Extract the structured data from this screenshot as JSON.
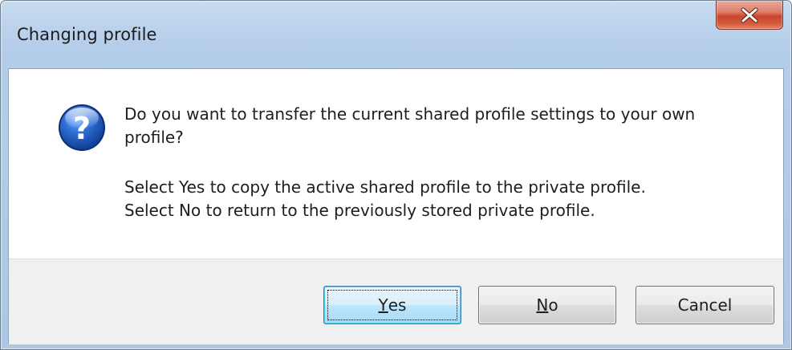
{
  "window": {
    "title": "Changing profile",
    "close_icon": "close-icon",
    "accent_color": "#c9462c"
  },
  "dialog": {
    "icon": "question-icon",
    "icon_color": "#2a5bb5",
    "question": "Do you want to transfer the current shared profile settings to your own profile?",
    "detail_line_1": "Select Yes to copy the active shared profile to the private profile.",
    "detail_line_2": "Select No to return to the previously stored private profile."
  },
  "buttons": {
    "yes": {
      "accel": "Y",
      "rest": "es",
      "focused": true
    },
    "no": {
      "accel": "N",
      "rest": "o"
    },
    "cancel": {
      "label": "Cancel"
    }
  }
}
